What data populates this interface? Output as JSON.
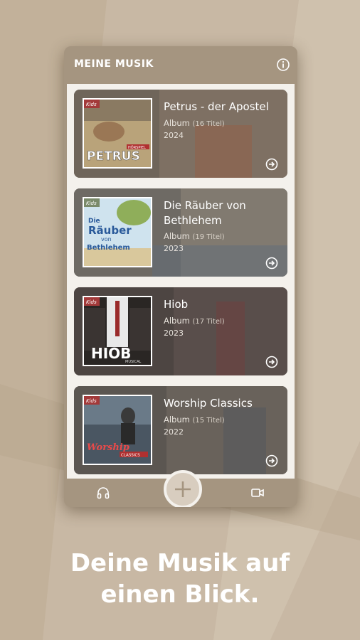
{
  "header": {
    "title": "MEINE MUSIK"
  },
  "albums": [
    {
      "title": "Petrus - der Apostel",
      "type": "Album",
      "tracks": "(16 Titel)",
      "year": "2024",
      "cover_text": "PETRUS",
      "cover_badge": "HÖRSPIEL",
      "logo": "Kids"
    },
    {
      "title": "Die Räuber von Bethlehem",
      "type": "Album",
      "tracks": "(19 Titel)",
      "year": "2023",
      "cover_text_1": "Die",
      "cover_text_2": "Räuber",
      "cover_text_3": "von",
      "cover_text_4": "Bethlehem",
      "logo": "Kids"
    },
    {
      "title": "Hiob",
      "type": "Album",
      "tracks": "(17 Titel)",
      "year": "2023",
      "cover_text": "HIOB",
      "cover_badge": "MUSICAL",
      "logo": "Kids"
    },
    {
      "title": "Worship Classics",
      "type": "Album",
      "tracks": "(15 Titel)",
      "year": "2022",
      "cover_text": "Worship",
      "cover_badge": "CLASSICS",
      "logo": "Kids"
    }
  ],
  "tagline": {
    "line1": "Deine Musik auf",
    "line2": "einen Blick."
  },
  "icons": {
    "info": "info-icon",
    "arrow": "arrow-right-circle-icon",
    "headphones": "headphones-icon",
    "video": "video-icon",
    "add": "plus-icon"
  },
  "colors": {
    "accent": "#a59580",
    "background": "#c8b8a4",
    "content": "#f4f1ec"
  }
}
